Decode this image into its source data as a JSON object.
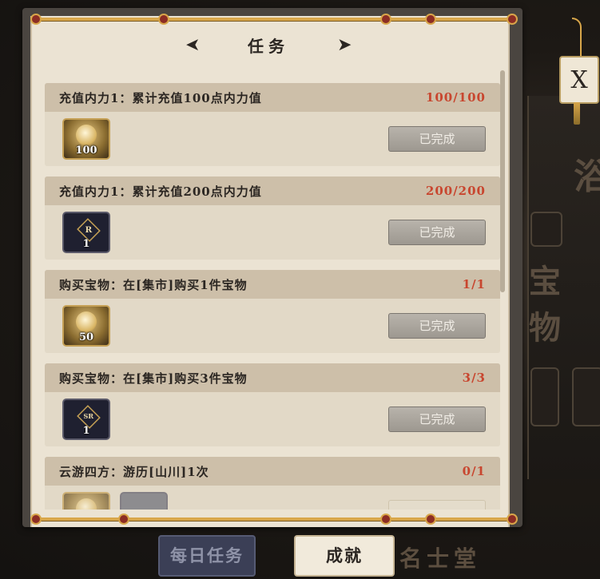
{
  "header": {
    "title": "任务",
    "prev_arrow": "➤",
    "next_arrow": "➤"
  },
  "close": {
    "label": "X"
  },
  "background": {
    "glyph_top": "浴",
    "glyph_mid": "宝 物",
    "glyph_bottom": "名士堂"
  },
  "tasks": [
    {
      "name": "充值内力1：累计充值100点内力值",
      "progress": "100/100",
      "button": "已完成",
      "rewards": [
        {
          "icon": "gold-coin-icon",
          "count": "100"
        }
      ]
    },
    {
      "name": "充值内力1：累计充值200点内力值",
      "progress": "200/200",
      "button": "已完成",
      "rewards": [
        {
          "icon": "r-rank-ticket-icon",
          "rank": "R",
          "count": "1"
        }
      ]
    },
    {
      "name": "购买宝物：在[集市]购买1件宝物",
      "progress": "1/1",
      "button": "已完成",
      "rewards": [
        {
          "icon": "gold-coin-icon",
          "count": "50"
        }
      ]
    },
    {
      "name": "购买宝物：在[集市]购买3件宝物",
      "progress": "3/3",
      "button": "已完成",
      "rewards": [
        {
          "icon": "sr-rank-ticket-icon",
          "rank": "SR",
          "count": "1"
        }
      ]
    },
    {
      "name": "云游四方：游历[山川]1次",
      "progress": "0/1",
      "button": "",
      "rewards": [
        {
          "icon": "gold-coin-icon",
          "count": ""
        },
        {
          "icon": "rank-ticket-icon",
          "rank": "",
          "count": ""
        }
      ]
    }
  ],
  "tabs": [
    {
      "label": "每日任务",
      "active": false
    },
    {
      "label": "成就",
      "active": true
    }
  ],
  "colors": {
    "progress_text": "#c8462f",
    "paper": "#ebe3d3",
    "rod": "#d8a64a"
  }
}
